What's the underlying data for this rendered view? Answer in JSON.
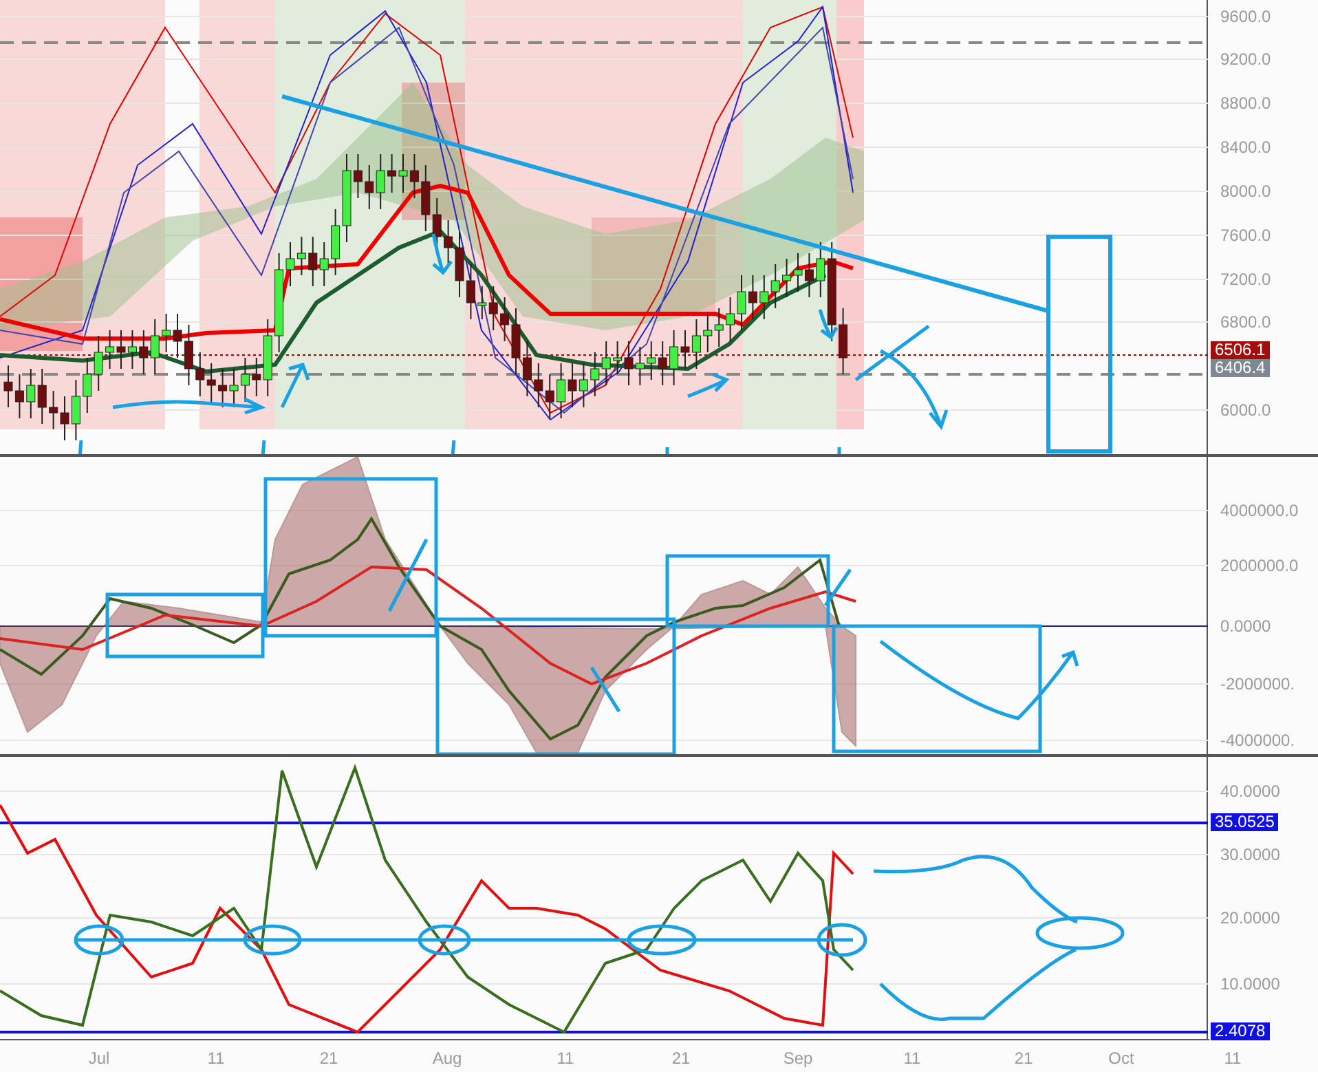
{
  "price_pane": {
    "y_ticks": [
      "9600.0",
      "9200.0",
      "8800.0",
      "8400.0",
      "8000.0",
      "7600.0",
      "7200.0",
      "6800.0",
      "6000.0"
    ],
    "badges": [
      {
        "label": "6506.1",
        "color": "#a50d0d"
      },
      {
        "label": "6406.4",
        "color": "#7f8790"
      }
    ]
  },
  "volume_pane": {
    "y_ticks": [
      "4000000.0",
      "2000000.0",
      "0.0000",
      "-2000000.",
      "-4000000."
    ]
  },
  "dmi_pane": {
    "y_ticks": [
      "40.0000",
      "30.0000",
      "20.0000",
      "10.0000"
    ],
    "badges": [
      {
        "label": "35.0525",
        "color": "#1010e0"
      },
      {
        "label": "2.4078",
        "color": "#1010e0"
      }
    ]
  },
  "x_axis": {
    "labels": [
      "Jul",
      "11",
      "21",
      "Aug",
      "11",
      "21",
      "Sep",
      "11",
      "21",
      "Oct",
      "11"
    ]
  }
}
